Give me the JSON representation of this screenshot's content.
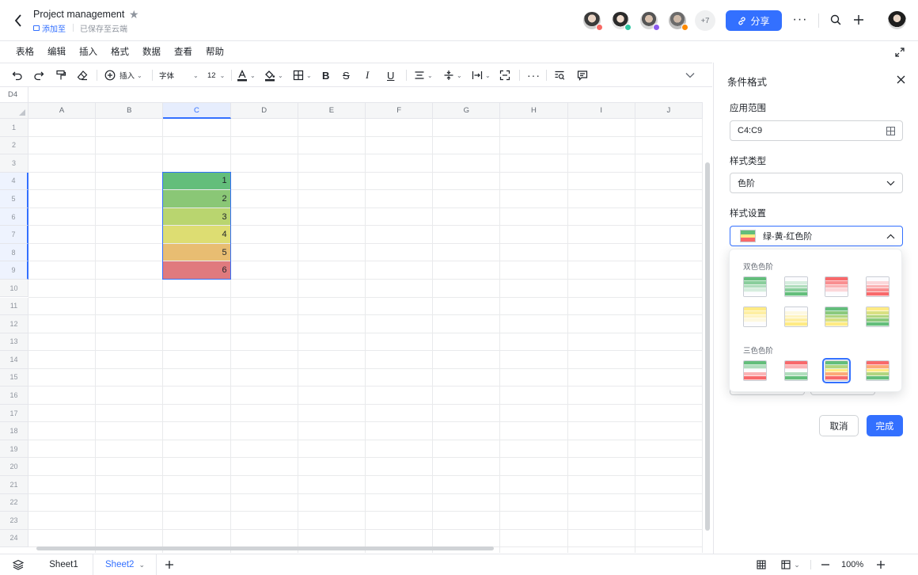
{
  "header": {
    "title": "Project management",
    "add_to": "添加至",
    "saved": "已保存至云端",
    "more_users": "+7",
    "share": "分享"
  },
  "menu": [
    "表格",
    "编辑",
    "插入",
    "格式",
    "数据",
    "查看",
    "帮助"
  ],
  "toolbar": {
    "insert": "插入",
    "font": "字体",
    "font_size": "12"
  },
  "namebox": "D4",
  "columns": [
    "A",
    "B",
    "C",
    "D",
    "E",
    "F",
    "G",
    "H",
    "I",
    "J"
  ],
  "rows": [
    "1",
    "2",
    "3",
    "4",
    "5",
    "6",
    "7",
    "8",
    "9",
    "10",
    "11",
    "12",
    "13",
    "14",
    "15",
    "16",
    "17",
    "18",
    "19",
    "20",
    "21",
    "22",
    "23",
    "24"
  ],
  "cells": [
    {
      "ref": "C4",
      "value": "1",
      "color": "#63be7b"
    },
    {
      "ref": "C5",
      "value": "2",
      "color": "#8ac776"
    },
    {
      "ref": "C6",
      "value": "3",
      "color": "#b9d56f"
    },
    {
      "ref": "C7",
      "value": "4",
      "color": "#dddd72"
    },
    {
      "ref": "C8",
      "value": "5",
      "color": "#e8bd72"
    },
    {
      "ref": "C9",
      "value": "6",
      "color": "#e07a7e"
    }
  ],
  "sheets": [
    "Sheet1",
    "Sheet2"
  ],
  "zoom": "100%",
  "panel": {
    "title": "条件格式",
    "range_label": "应用范围",
    "range_value": "C4:C9",
    "type_label": "样式类型",
    "type_value": "色阶",
    "style_label": "样式设置",
    "style_value": "绿-黄-红色阶",
    "two_color_label": "双色色阶",
    "three_color_label": "三色色阶",
    "cancel": "取消",
    "done": "完成"
  },
  "colors": {
    "accent": "#3370ff",
    "green": "#63be7b",
    "yellow": "#ffeb84",
    "red": "#f8696b"
  }
}
